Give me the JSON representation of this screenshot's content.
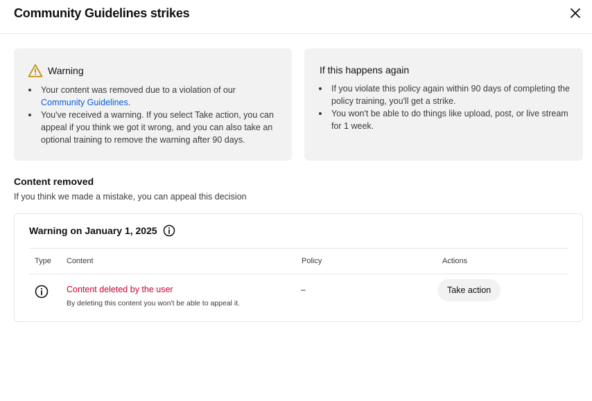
{
  "dialog": {
    "title": "Community Guidelines strikes",
    "close_icon": "close-icon"
  },
  "warning_card": {
    "icon": "warning-triangle-icon",
    "heading": "Warning",
    "items": [
      {
        "text_before": "Your content was removed due to a violation of our ",
        "link": "Community Guidelines",
        "text_after": "."
      },
      {
        "text": "You've received a warning. If you select Take action, you can appeal if you think we got it wrong, and you can also take an optional training to remove the warning after 90 days."
      }
    ]
  },
  "again_card": {
    "heading": "If this happens again",
    "items": [
      "If you violate this policy again within 90 days of completing the policy training, you'll get a strike.",
      "You won't be able to do things like upload, post, or live stream for 1 week."
    ]
  },
  "content_removed": {
    "title": "Content removed",
    "subtitle": "If you think we made a mistake, you can appeal this decision"
  },
  "warning_box": {
    "heading": "Warning on January 1, 2025",
    "info_icon": "info-icon",
    "columns": [
      "Type",
      "Content",
      "Policy",
      "Actions"
    ],
    "row": {
      "type_icon": "info-icon",
      "content_title": "Content deleted by the user",
      "content_note": "By deleting this content you won't be able to appeal it.",
      "policy": "–",
      "action_label": "Take action"
    }
  },
  "colors": {
    "accent_link": "#065fd4",
    "deleted_red": "#cc0033",
    "warning_icon": "#c28a00",
    "card_bg": "#f2f2f2"
  }
}
